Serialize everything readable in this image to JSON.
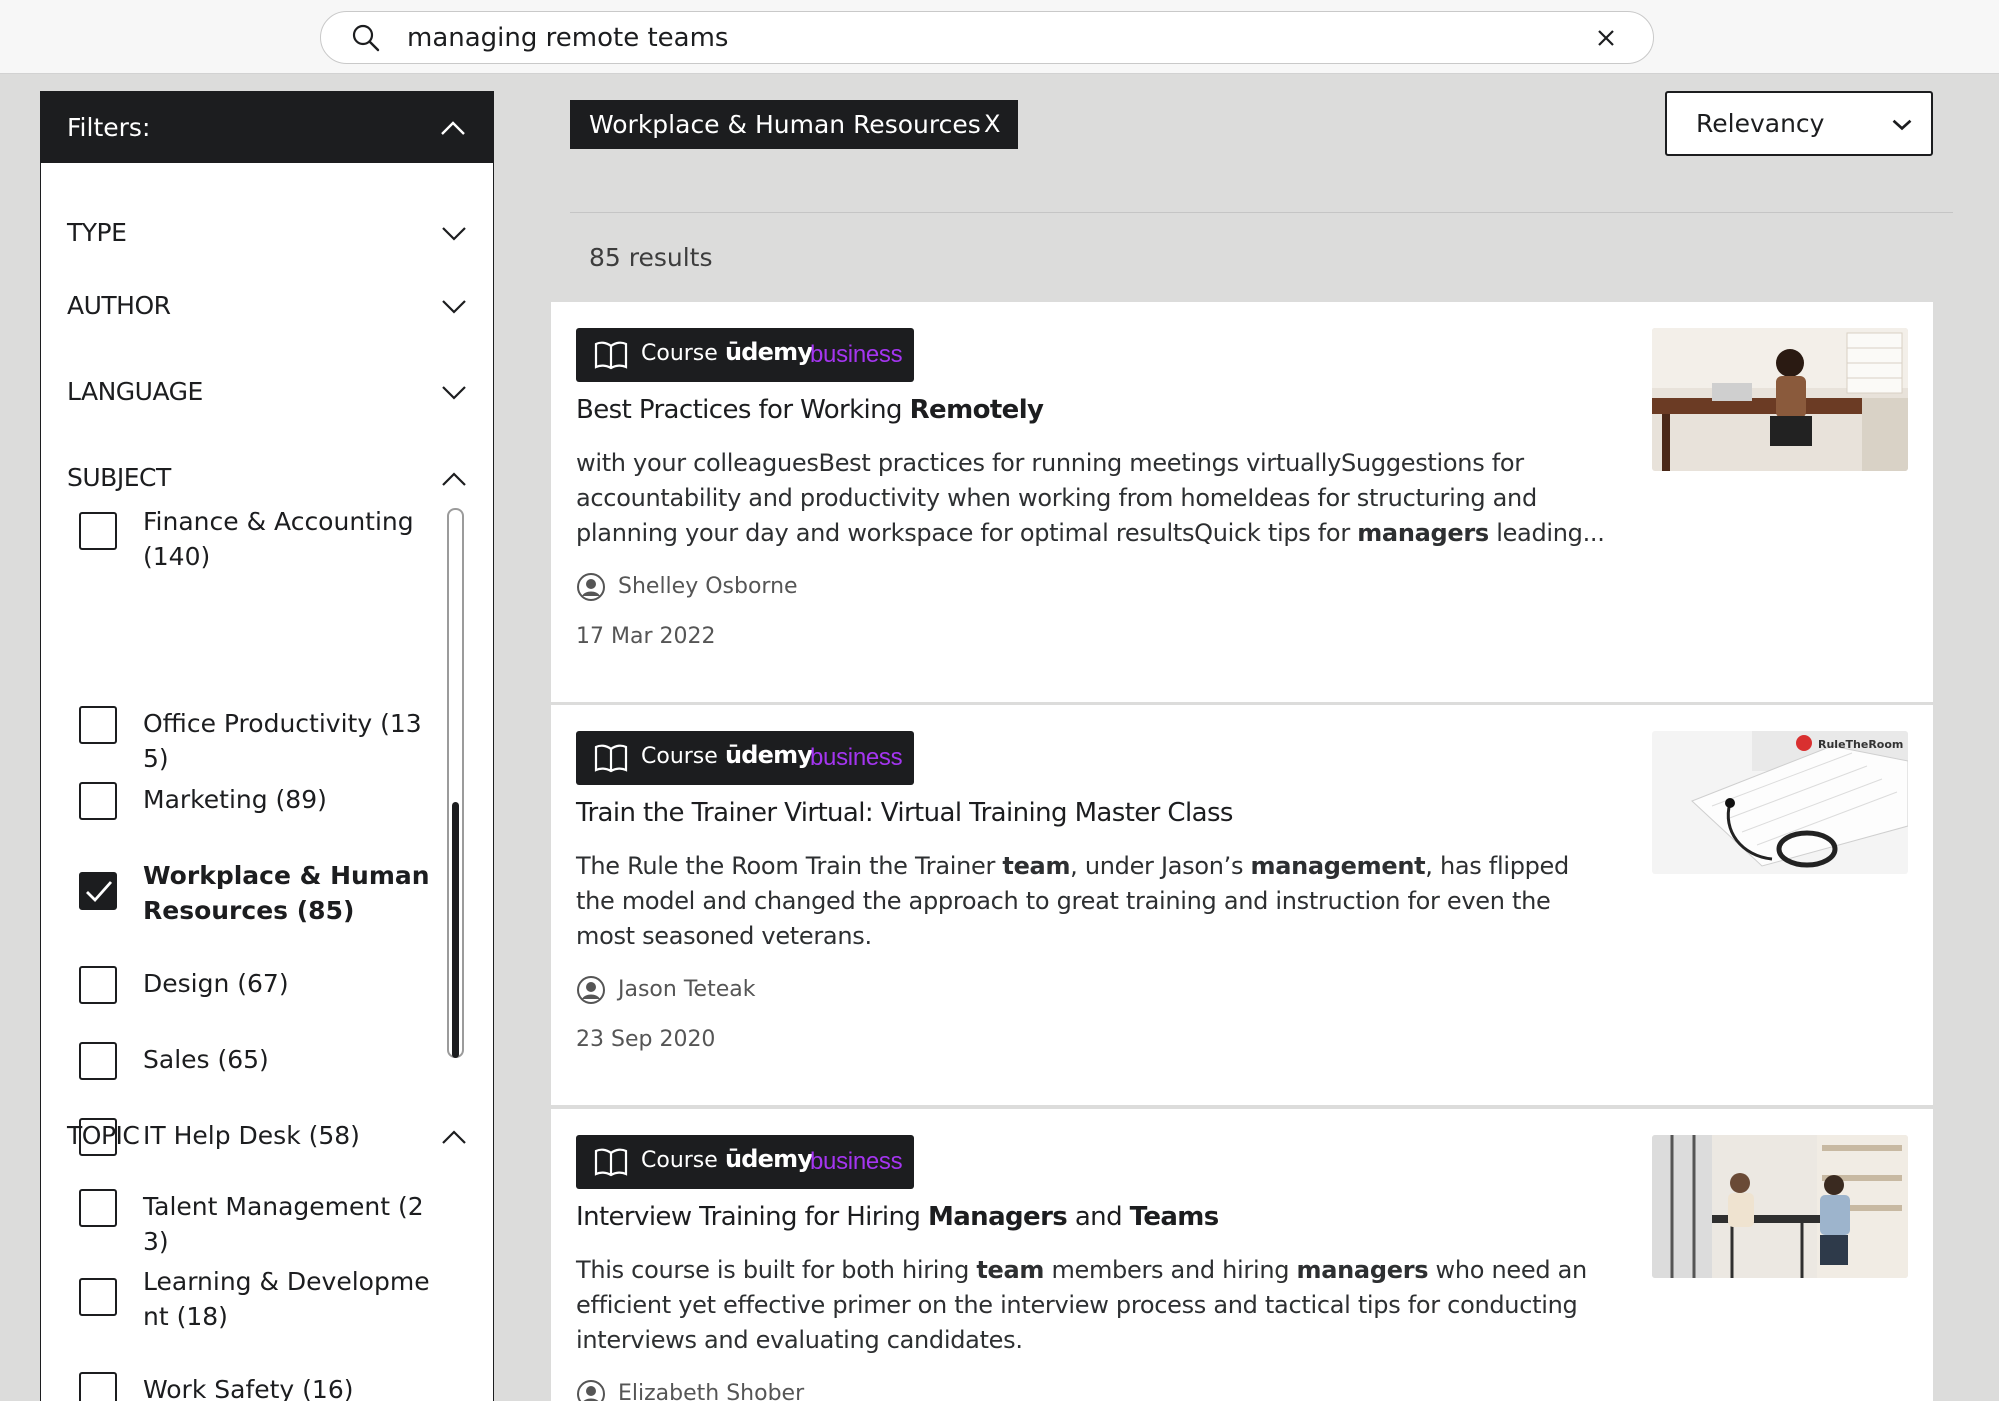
{
  "search": {
    "query": "managing remote teams"
  },
  "sidebar": {
    "header": "Filters:",
    "facets": {
      "type": "TYPE",
      "author": "AUTHOR",
      "language": "LANGUAGE",
      "subject": "SUBJECT",
      "topic": "TOPIC"
    },
    "subject_options": [
      {
        "label": "Finance & Accounting (140)",
        "checked": false
      },
      {
        "label": "Office Productivity (135)",
        "checked": false
      },
      {
        "label": "Marketing (89)",
        "checked": false
      },
      {
        "label": "Workplace & Human Resources (85)",
        "checked": true
      },
      {
        "label": "Design (67)",
        "checked": false
      },
      {
        "label": "Sales (65)",
        "checked": false
      },
      {
        "label": "IT Help Desk (58)",
        "checked": false
      }
    ],
    "topic_options": [
      {
        "label": "Talent Management (23)",
        "checked": false
      },
      {
        "label": "Learning & Development (18)",
        "checked": false
      },
      {
        "label": "Work Safety (16)",
        "checked": false
      }
    ]
  },
  "active_filter": {
    "label": "Workplace & Human Resources",
    "remove": "X"
  },
  "sort": {
    "selected": "Relevancy"
  },
  "results": {
    "count_label": "85 results"
  },
  "badge": {
    "type": "Course",
    "brand_main": "ūdemy",
    "brand_sub": "business"
  },
  "cards": [
    {
      "title_plain": "Best Practices for Working ",
      "title_bold": "Remotely",
      "desc_1": "with your colleaguesBest practices for running meetings virtuallySuggestions for accountability and productivity when working from homeIdeas for structuring and planning your day and workspace for optimal resultsQuick tips for ",
      "desc_bold_1": "managers",
      "desc_2": " leading...",
      "author": "Shelley Osborne",
      "date": "17 Mar 2022"
    },
    {
      "title_plain": "Train the Trainer Virtual: Virtual Training Master Class",
      "desc_1": "The Rule the Room Train the Trainer ",
      "desc_bold_1": "team",
      "desc_2": ", under Jason’s ",
      "desc_bold_2": "management",
      "desc_3": ", has flipped the model and changed the approach to great training and instruction for even the most seasoned veterans.",
      "author": "Jason Teteak",
      "date": "23 Sep 2020",
      "thumb_logo": "RuleTheRoom"
    },
    {
      "title_plain": "Interview Training for Hiring ",
      "title_bold_1": "Managers",
      "title_mid": " and ",
      "title_bold_2": "Teams",
      "desc_1": "This course is built for both hiring ",
      "desc_bold_1": "team",
      "desc_2": " members and hiring ",
      "desc_bold_2": "managers",
      "desc_3": " who need an efficient yet effective primer on the interview process and tactical tips for conducting interviews and evaluating candidates.",
      "author": "Elizabeth Shober"
    }
  ]
}
